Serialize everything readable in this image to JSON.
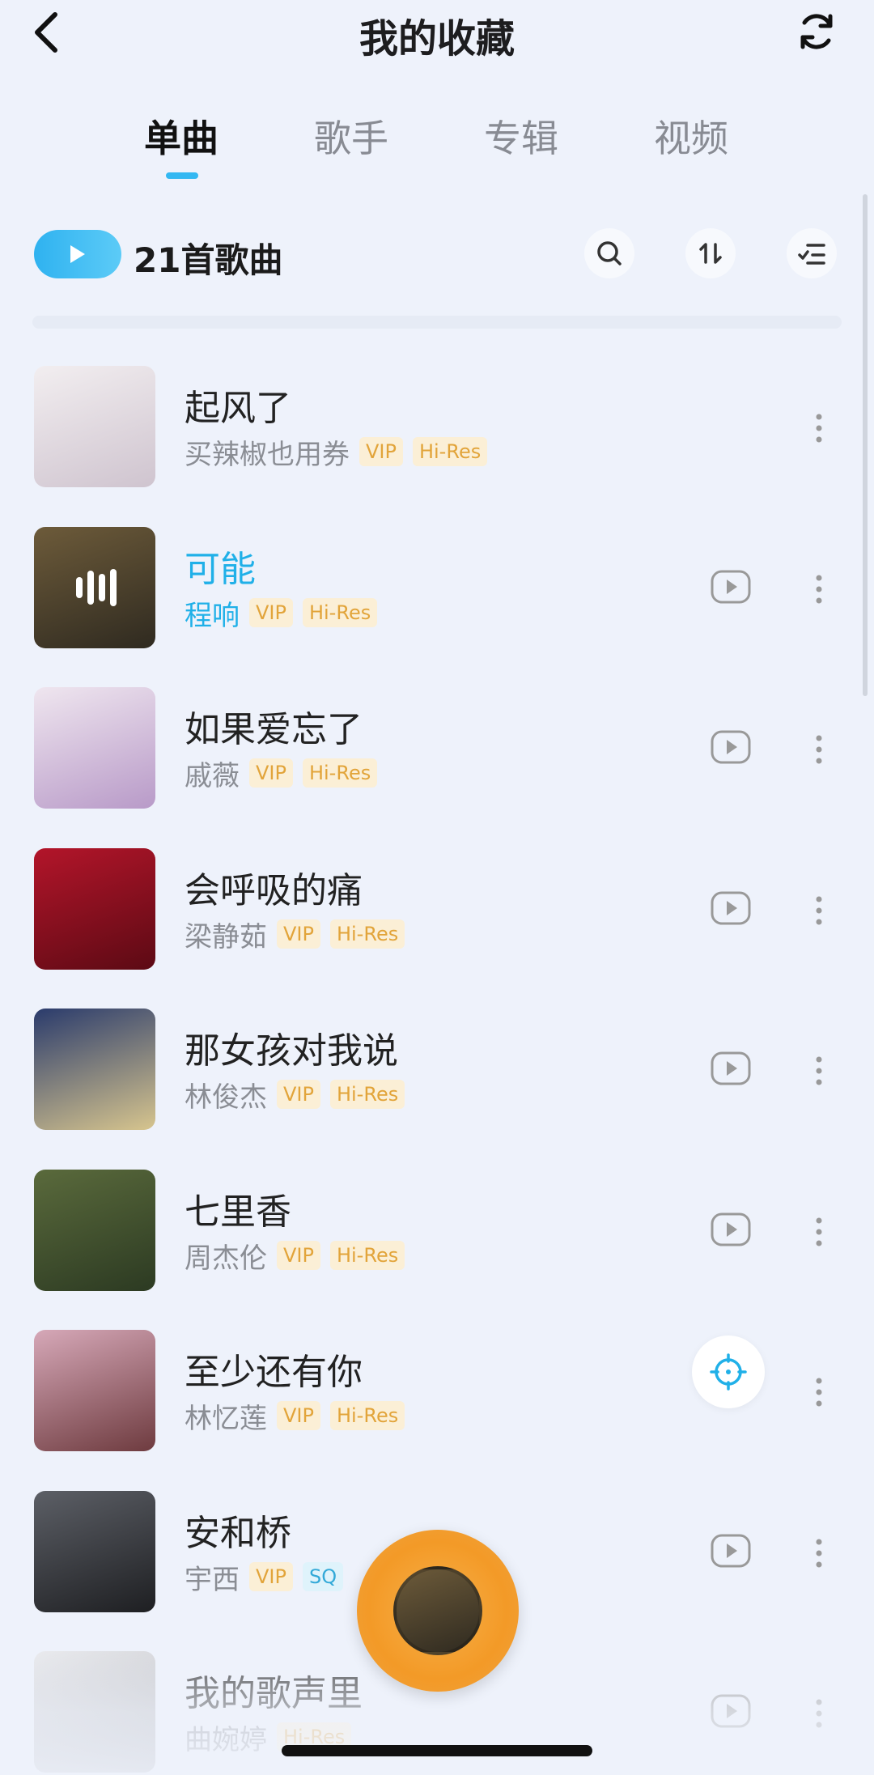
{
  "header": {
    "title": "我的收藏"
  },
  "tabs": [
    {
      "label": "单曲",
      "active": true
    },
    {
      "label": "歌手",
      "active": false
    },
    {
      "label": "专辑",
      "active": false
    },
    {
      "label": "视频",
      "active": false
    }
  ],
  "toolbar": {
    "count_label": "21首歌曲"
  },
  "songs": [
    {
      "title": "起风了",
      "artist": "买辣椒也用券",
      "tags": [
        "VIP",
        "Hi-Res"
      ],
      "has_mv": false,
      "current": false,
      "cover_colors": [
        "#f2eef0",
        "#cfc4cf"
      ]
    },
    {
      "title": "可能",
      "artist": "程响",
      "tags": [
        "VIP",
        "Hi-Res"
      ],
      "has_mv": true,
      "current": true,
      "cover_colors": [
        "#6d5b3a",
        "#2f2a20"
      ]
    },
    {
      "title": "如果爱忘了",
      "artist": "戚薇",
      "tags": [
        "VIP",
        "Hi-Res"
      ],
      "has_mv": true,
      "current": false,
      "cover_colors": [
        "#efe6ef",
        "#b89ac8"
      ]
    },
    {
      "title": "会呼吸的痛",
      "artist": "梁静茹",
      "tags": [
        "VIP",
        "Hi-Res"
      ],
      "has_mv": true,
      "current": false,
      "cover_colors": [
        "#b3152a",
        "#5c0a14"
      ]
    },
    {
      "title": "那女孩对我说",
      "artist": "林俊杰",
      "tags": [
        "VIP",
        "Hi-Res"
      ],
      "has_mv": true,
      "current": false,
      "cover_colors": [
        "#2a3b6c",
        "#d7c58e"
      ]
    },
    {
      "title": "七里香",
      "artist": "周杰伦",
      "tags": [
        "VIP",
        "Hi-Res"
      ],
      "has_mv": true,
      "current": false,
      "cover_colors": [
        "#5a6a3c",
        "#2c3a22"
      ]
    },
    {
      "title": "至少还有你",
      "artist": "林忆莲",
      "tags": [
        "VIP",
        "Hi-Res"
      ],
      "has_mv": false,
      "current": false,
      "cover_colors": [
        "#d6a8b8",
        "#6e3b3f"
      ]
    },
    {
      "title": "安和桥",
      "artist": "宇西",
      "tags": [
        "VIP",
        "SQ"
      ],
      "has_mv": true,
      "current": false,
      "cover_colors": [
        "#5c5f66",
        "#1e1f22"
      ]
    },
    {
      "title": "我的歌声里",
      "artist": "曲婉婷",
      "tags": [
        "Hi-Res"
      ],
      "has_mv": true,
      "current": false,
      "cover_colors": [
        "#e8e8ea",
        "#9b9b9f"
      ]
    }
  ],
  "colors": {
    "accent": "#20b0e8",
    "vip_tag": "#e2a43a",
    "sq_tag": "#33a9d8",
    "disc": "#f39a27"
  },
  "icons": {
    "back": "chevron-left-icon",
    "refresh": "refresh-icon",
    "search": "search-icon",
    "sort": "sort-icon",
    "multi_select": "multi-select-icon",
    "play": "play-icon",
    "mv": "mv-icon",
    "more": "more-vertical-icon",
    "locate": "locate-icon",
    "playing": "playing-bars-icon"
  }
}
